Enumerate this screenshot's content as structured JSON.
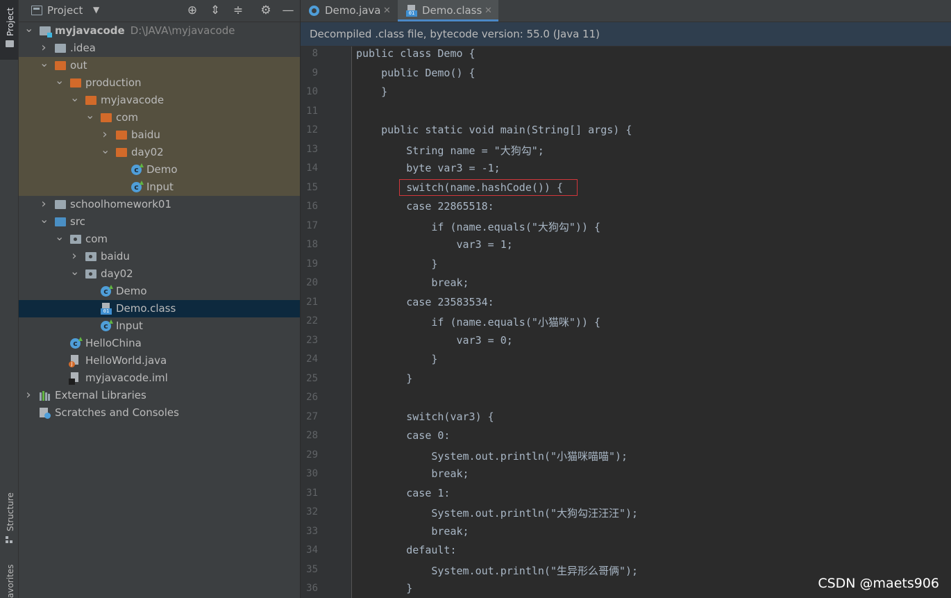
{
  "left_strip": {
    "project_label": "Project",
    "structure_label": "Structure",
    "favorites_label": "avorites"
  },
  "project_panel": {
    "title": "Project",
    "tree": [
      {
        "label": "myjavacode",
        "hint": "D:\\JAVA\\myjavacode",
        "icon": "module-folder-icon",
        "expanded": true
      },
      {
        "label": ".idea",
        "icon": "folder-icon",
        "expanded": false
      },
      {
        "label": "out",
        "icon": "excluded-folder-icon",
        "expanded": true
      },
      {
        "label": "production",
        "icon": "excluded-folder-icon",
        "expanded": true
      },
      {
        "label": "myjavacode",
        "icon": "excluded-folder-icon",
        "expanded": true
      },
      {
        "label": "com",
        "icon": "excluded-folder-icon",
        "expanded": true
      },
      {
        "label": "baidu",
        "icon": "excluded-folder-icon",
        "expanded": false
      },
      {
        "label": "day02",
        "icon": "excluded-folder-icon",
        "expanded": true
      },
      {
        "label": "Demo",
        "icon": "class-icon"
      },
      {
        "label": "Input",
        "icon": "class-icon"
      },
      {
        "label": "schoolhomework01",
        "icon": "folder-icon",
        "expanded": false
      },
      {
        "label": "src",
        "icon": "source-folder-icon",
        "expanded": true
      },
      {
        "label": "com",
        "icon": "package-icon",
        "expanded": true
      },
      {
        "label": "baidu",
        "icon": "package-icon",
        "expanded": false
      },
      {
        "label": "day02",
        "icon": "package-icon",
        "expanded": true
      },
      {
        "label": "Demo",
        "icon": "class-icon"
      },
      {
        "label": "Demo.class",
        "icon": "class-file-icon",
        "selected": true
      },
      {
        "label": "Input",
        "icon": "class-icon"
      },
      {
        "label": "HelloChina",
        "icon": "class-icon"
      },
      {
        "label": "HelloWorld.java",
        "icon": "java-file-icon"
      },
      {
        "label": "myjavacode.iml",
        "icon": "iml-file-icon"
      },
      {
        "label": "External Libraries",
        "icon": "libraries-icon",
        "expanded": false
      },
      {
        "label": "Scratches and Consoles",
        "icon": "scratches-icon"
      }
    ]
  },
  "editor": {
    "tabs": [
      {
        "label": "Demo.java",
        "active": false
      },
      {
        "label": "Demo.class",
        "active": true
      }
    ],
    "banner": "Decompiled .class file, bytecode version: 55.0 (Java 11)",
    "lines": [
      {
        "n": "8",
        "text": "public class Demo {"
      },
      {
        "n": "9",
        "text": "    public Demo() {"
      },
      {
        "n": "10",
        "text": "    }"
      },
      {
        "n": "11",
        "text": ""
      },
      {
        "n": "12",
        "text": "    public static void main(String[] args) {"
      },
      {
        "n": "13",
        "text": "        String name = \"大狗勾\";"
      },
      {
        "n": "14",
        "text": "        byte var3 = -1;"
      },
      {
        "n": "15",
        "text": "        switch(name.hashCode()) {"
      },
      {
        "n": "16",
        "text": "        case 22865518:"
      },
      {
        "n": "17",
        "text": "            if (name.equals(\"大狗勾\")) {"
      },
      {
        "n": "18",
        "text": "                var3 = 1;"
      },
      {
        "n": "19",
        "text": "            }"
      },
      {
        "n": "20",
        "text": "            break;"
      },
      {
        "n": "21",
        "text": "        case 23583534:"
      },
      {
        "n": "22",
        "text": "            if (name.equals(\"小猫咪\")) {"
      },
      {
        "n": "23",
        "text": "                var3 = 0;"
      },
      {
        "n": "24",
        "text": "            }"
      },
      {
        "n": "25",
        "text": "        }"
      },
      {
        "n": "26",
        "text": ""
      },
      {
        "n": "27",
        "text": "        switch(var3) {"
      },
      {
        "n": "28",
        "text": "        case 0:"
      },
      {
        "n": "29",
        "text": "            System.out.println(\"小猫咪喵喵\");"
      },
      {
        "n": "30",
        "text": "            break;"
      },
      {
        "n": "31",
        "text": "        case 1:"
      },
      {
        "n": "32",
        "text": "            System.out.println(\"大狗勾汪汪汪\");"
      },
      {
        "n": "33",
        "text": "            break;"
      },
      {
        "n": "34",
        "text": "        default:"
      },
      {
        "n": "35",
        "text": "            System.out.println(\"生异形么哥俩\");"
      },
      {
        "n": "36",
        "text": "        }"
      }
    ]
  },
  "watermark": "CSDN @maets906",
  "colors": {
    "accent": "#4a88c7",
    "highlight_border": "#d2363b",
    "excluded_band": "#55503f",
    "selection": "#0d293e"
  }
}
